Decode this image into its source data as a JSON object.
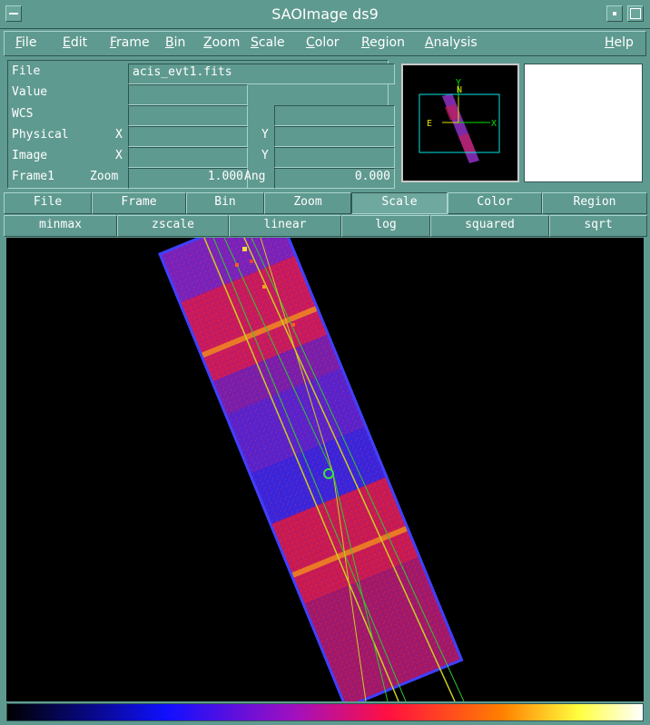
{
  "window": {
    "title": "SAOImage ds9"
  },
  "menu": {
    "items": [
      {
        "label": "File"
      },
      {
        "label": "Edit"
      },
      {
        "label": "Frame"
      },
      {
        "label": "Bin"
      },
      {
        "label": "Zoom"
      },
      {
        "label": "Scale"
      },
      {
        "label": "Color"
      },
      {
        "label": "Region"
      },
      {
        "label": "Analysis"
      }
    ],
    "help": "Help"
  },
  "info": {
    "file_label": "File",
    "file_value": "acis_evt1.fits",
    "value_label": "Value",
    "value_value": "",
    "wcs_label": "WCS",
    "physical_label": "Physical",
    "image_label": "Image",
    "x_label": "X",
    "y_label": "Y",
    "frame_label": "Frame1",
    "zoom_label": "Zoom",
    "zoom_value": "1.000",
    "ang_label": "Ang",
    "ang_value": "0.000"
  },
  "panner": {
    "x_label": "X",
    "y_label": "Y",
    "e_label": "E",
    "n_label": "N"
  },
  "buttonbar": {
    "main": [
      {
        "label": "File"
      },
      {
        "label": "Frame"
      },
      {
        "label": "Bin"
      },
      {
        "label": "Zoom"
      },
      {
        "label": "Scale",
        "active": true
      },
      {
        "label": "Color"
      },
      {
        "label": "Region"
      }
    ],
    "scale": [
      {
        "label": "minmax"
      },
      {
        "label": "zscale"
      },
      {
        "label": "linear"
      },
      {
        "label": "log"
      },
      {
        "label": "squared"
      },
      {
        "label": "sqrt"
      }
    ]
  },
  "colors": {
    "bg": "#5f9a90",
    "dark": "#2f5550",
    "light": "#a8d4cc"
  }
}
